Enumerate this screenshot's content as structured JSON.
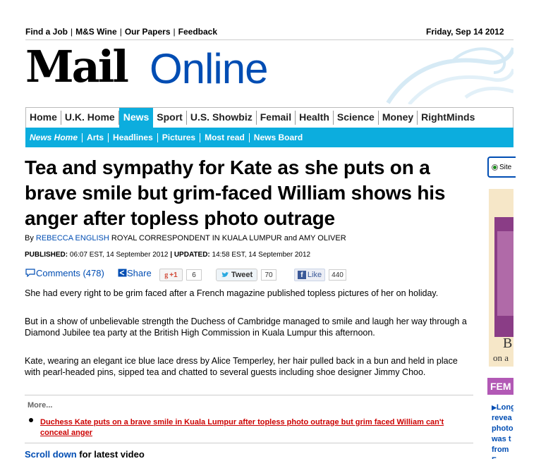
{
  "utility_bar": {
    "links": [
      "Find a Job",
      "M&S Wine",
      "Our Papers",
      "Feedback"
    ],
    "date": "Friday, Sep 14 2012"
  },
  "logo": {
    "mail": "Mail",
    "online": "Online"
  },
  "nav": {
    "items": [
      "Home",
      "U.K. Home",
      "News",
      "Sport",
      "U.S. Showbiz",
      "Femail",
      "Health",
      "Science",
      "Money",
      "RightMinds"
    ],
    "active": "News"
  },
  "subnav": {
    "items": [
      "News Home",
      "Arts",
      "Headlines",
      "Pictures",
      "Most read",
      "News Board"
    ]
  },
  "article": {
    "headline": "Tea and sympathy for Kate as she puts on a brave smile but grim-faced William shows his anger after topless photo outrage",
    "byline_prefix": "By",
    "author1": "REBECCA ENGLISH",
    "byline_mid": "ROYAL CORRESPONDENT IN KUALA LUMPUR and",
    "author2": "AMY OLIVER",
    "published_label": "PUBLISHED:",
    "published": "06:07 EST, 14 September 2012",
    "updated_label": "UPDATED:",
    "updated": "14:58 EST, 14 September 2012",
    "paragraphs": [
      "She had every right to be grim faced after a French magazine published topless pictures of her on holiday.",
      "But in a show of unbelievable strength the Duchess of Cambridge managed to smile and laugh her way through a Diamond Jubilee tea party at the British High Commission in Kuala Lumpur this afternoon.",
      "Kate, wearing an elegant ice blue lace dress by Alice Temperley, her hair pulled back in a bun and held in place with pearl-headed pins, sipped tea and chatted to several guests including shoe designer Jimmy Choo."
    ]
  },
  "social": {
    "comments": "Comments (478)",
    "share": "Share",
    "gplus": "+1",
    "gplus_count": "6",
    "tweet": "Tweet",
    "tweet_count": "70",
    "like": "Like",
    "like_count": "440"
  },
  "more": {
    "label": "More...",
    "links": [
      "Duchess Kate puts on a brave smile in Kuala Lumpur after topless photo outrage but grim faced William can't conceal anger"
    ]
  },
  "scroll": {
    "link": "Scroll down",
    "rest": "for latest video"
  },
  "sidebar": {
    "search_option": "Site",
    "ad_letter": "B",
    "ad_text": "on a",
    "femail_heading": "FEM",
    "femail_lines": [
      "Long",
      "revea",
      "photo",
      "was t",
      "from",
      "F"
    ]
  },
  "colors": {
    "brand_blue": "#004db3",
    "nav_cyan": "#0cadde",
    "femail_purple": "#b259b5",
    "link_red": "#cc0000"
  }
}
